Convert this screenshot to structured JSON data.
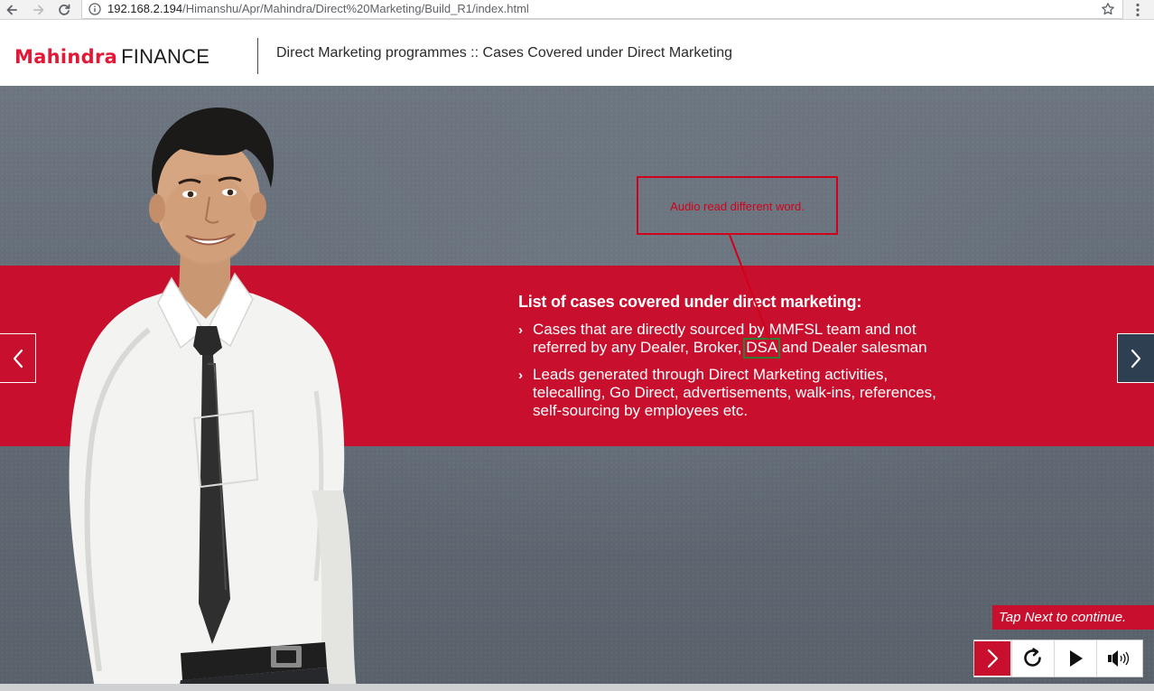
{
  "browser": {
    "url_host": "192.168.2.194",
    "url_path": "/Himanshu/Apr/Mahindra/Direct%20Marketing/Build_R1/index.html",
    "back_icon": "arrow-left-icon",
    "forward_icon": "arrow-right-icon",
    "reload_icon": "reload-icon",
    "info_icon": "info-icon",
    "bookmark_icon": "star-icon",
    "menu_icon": "more-vertical-icon"
  },
  "header": {
    "brand_primary": "Mahindra",
    "brand_secondary": "FINANCE",
    "title": "Direct Marketing programmes :: Cases Covered under Direct Marketing"
  },
  "slide": {
    "heading": "List of cases covered under direct marketing:",
    "bullets": [
      {
        "before": "Cases that are directly sourced by MMFSL team and not referred by any Dealer, Broker, ",
        "highlight": "DSA",
        "after": " and Dealer salesman"
      },
      {
        "text": "Leads generated through Direct Marketing activities, telecalling, Go Direct, advertisements, walk-ins, references, self-sourcing by employees etc."
      }
    ],
    "bullet_marker": "›"
  },
  "annotation": {
    "text": "Audio read different word."
  },
  "navigation": {
    "prev_icon": "chevron-left-icon",
    "next_icon": "chevron-right-icon",
    "tap_next": "Tap Next to continue."
  },
  "controls": {
    "items": [
      "next-icon",
      "replay-icon",
      "play-icon",
      "volume-icon"
    ]
  },
  "colors": {
    "brand_red": "#c8102e",
    "nav_blue": "#2e3f52",
    "annotation_red": "#d0021b",
    "highlight_green": "#2e7d32"
  }
}
